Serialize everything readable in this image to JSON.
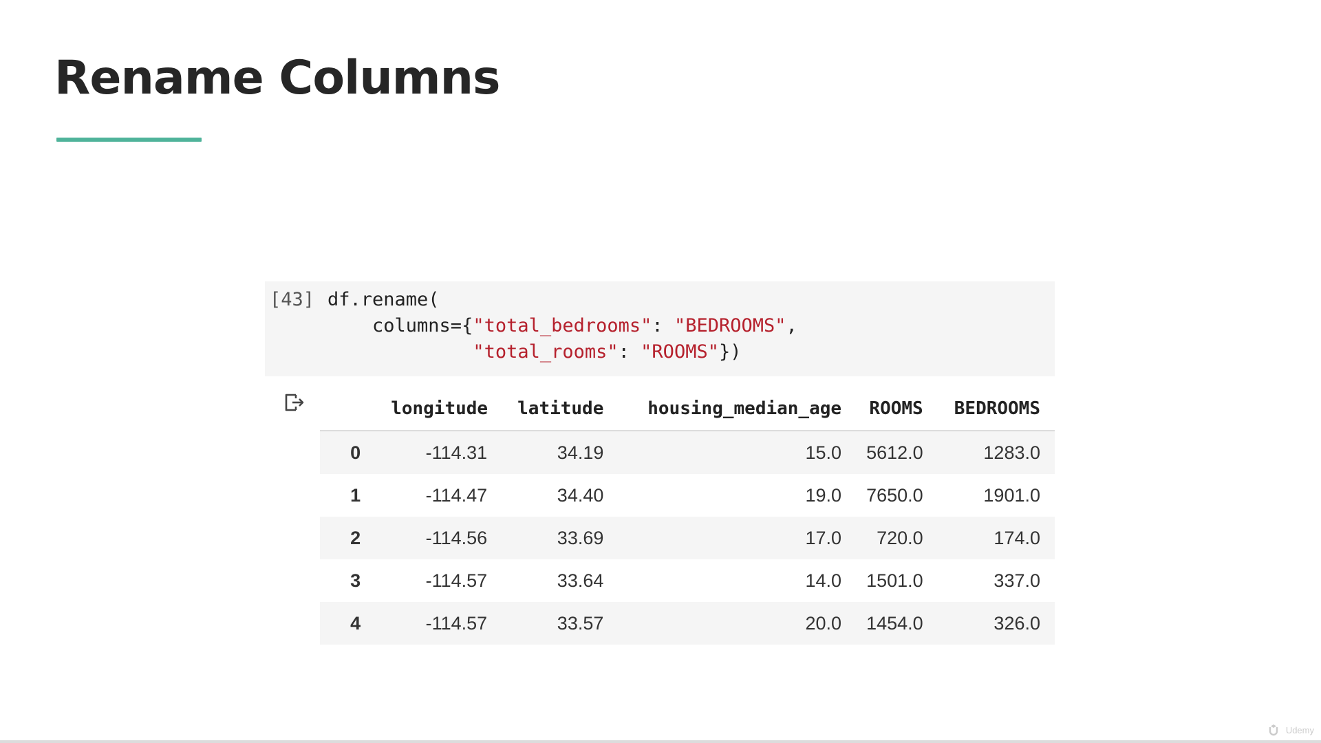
{
  "slide": {
    "title": "Rename Columns"
  },
  "code_cell": {
    "execution_count": "[43]",
    "lines": [
      [
        {
          "text": "df.rename(",
          "type": "plain"
        }
      ],
      [
        {
          "text": "    columns={",
          "type": "plain"
        },
        {
          "text": "\"total_bedrooms\"",
          "type": "string"
        },
        {
          "text": ": ",
          "type": "plain"
        },
        {
          "text": "\"BEDROOMS\"",
          "type": "string"
        },
        {
          "text": ",",
          "type": "plain"
        }
      ],
      [
        {
          "text": "             ",
          "type": "plain"
        },
        {
          "text": "\"total_rooms\"",
          "type": "string"
        },
        {
          "text": ": ",
          "type": "plain"
        },
        {
          "text": "\"ROOMS\"",
          "type": "string"
        },
        {
          "text": "})",
          "type": "plain"
        }
      ]
    ]
  },
  "output": {
    "icon": "output-redirect-icon",
    "columns": [
      "",
      "longitude",
      "latitude",
      "housing_median_age",
      "ROOMS",
      "BEDROOMS"
    ],
    "rows": [
      {
        "index": "0",
        "values": [
          "-114.31",
          "34.19",
          "15.0",
          "5612.0",
          "1283.0"
        ]
      },
      {
        "index": "1",
        "values": [
          "-114.47",
          "34.40",
          "19.0",
          "7650.0",
          "1901.0"
        ]
      },
      {
        "index": "2",
        "values": [
          "-114.56",
          "33.69",
          "17.0",
          "720.0",
          "174.0"
        ]
      },
      {
        "index": "3",
        "values": [
          "-114.57",
          "33.64",
          "14.0",
          "1501.0",
          "337.0"
        ]
      },
      {
        "index": "4",
        "values": [
          "-114.57",
          "33.57",
          "20.0",
          "1454.0",
          "326.0"
        ]
      }
    ]
  },
  "watermark": {
    "logo": "udemy-logo-icon",
    "text": "Udemy"
  },
  "colors": {
    "accent": "#4fb39a",
    "code_string": "#b5202c",
    "code_background": "#f5f5f5",
    "stripe": "#f5f5f5"
  }
}
